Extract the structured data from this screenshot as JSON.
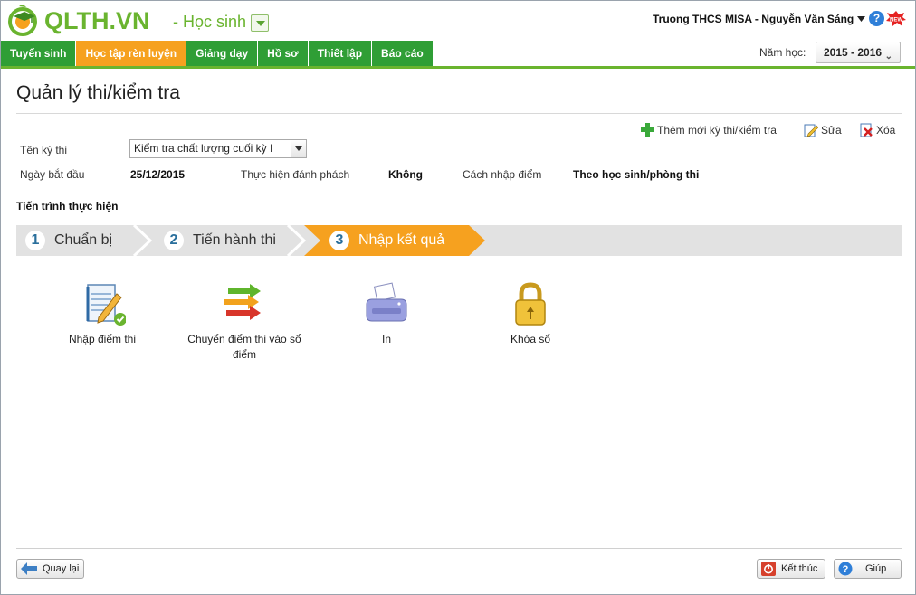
{
  "header": {
    "logo_text": "QLTH.VN",
    "app_name": "- Học sinh",
    "user": "Truong THCS MISA - Nguyễn Văn Sáng",
    "help_icon": "help-icon",
    "new_badge": "NEW"
  },
  "menu": {
    "items": [
      {
        "label": "Tuyển sinh"
      },
      {
        "label": "Học tập rèn luyện",
        "active": true
      },
      {
        "label": "Giảng dạy"
      },
      {
        "label": "Hồ sơ"
      },
      {
        "label": "Thiết lập"
      },
      {
        "label": "Báo cáo"
      }
    ],
    "year_label": "Năm học:",
    "year_value": "2015 - 2016",
    "accent": "#2f9e35",
    "active_color": "#f6a11f"
  },
  "page": {
    "title": "Quản lý thi/kiểm tra"
  },
  "toolbar": {
    "add_label": "Thêm mới kỳ thi/kiểm tra",
    "edit_label": "Sửa",
    "delete_label": "Xóa"
  },
  "form": {
    "exam_name_label": "Tên kỳ thi",
    "exam_name_value": "Kiểm tra chất lượng cuối kỳ I",
    "start_date_label": "Ngày bắt đầu",
    "start_date_value": "25/12/2015",
    "blind_label": "Thực hiện đánh phách",
    "blind_value": "Không",
    "entry_label": "Cách nhập điểm",
    "entry_value": "Theo học sinh/phòng thi"
  },
  "progress": {
    "title": "Tiến trình thực hiện",
    "steps": [
      {
        "num": "1",
        "label": "Chuẩn bị"
      },
      {
        "num": "2",
        "label": "Tiến hành thi"
      },
      {
        "num": "3",
        "label": "Nhập kết quả",
        "active": true
      }
    ]
  },
  "tiles": [
    {
      "label": "Nhập điểm thi",
      "icon": "notepad-pencil-icon",
      "done": true
    },
    {
      "label": "Chuyển điểm thi vào sổ điểm",
      "icon": "transfer-arrows-icon"
    },
    {
      "label": "In",
      "icon": "printer-icon"
    },
    {
      "label": "Khóa sổ",
      "icon": "padlock-icon"
    }
  ],
  "footer": {
    "back_label": "Quay lại",
    "finish_label": "Kết thúc",
    "help_label": "Giúp"
  }
}
